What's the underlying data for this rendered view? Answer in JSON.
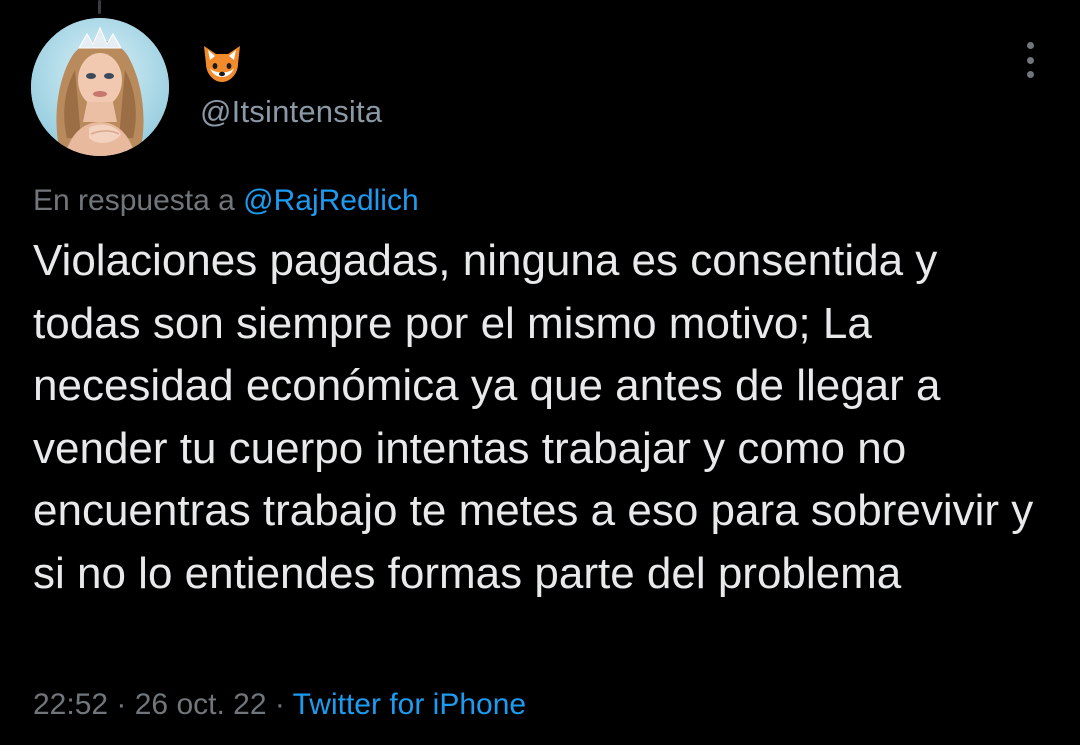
{
  "author": {
    "display_name_icon": "fox-face-emoji",
    "handle": "@Itsintensita",
    "avatar": "profile-photo"
  },
  "reply": {
    "prefix": "En respuesta a",
    "mention": "@RajRedlich"
  },
  "tweet": {
    "text": "Violaciones pagadas, ninguna es consentida y todas son siempre por el mismo motivo; La necesidad económica ya que antes de llegar a vender tu cuerpo intentas trabajar y como no encuentras trabajo te metes a eso para sobrevivir y si no lo entiendes formas parte del problema"
  },
  "meta": {
    "time": "22:52",
    "separator1": " · ",
    "date": "26 oct. 22",
    "separator2": " · ",
    "source": "Twitter for iPhone"
  },
  "menu": {
    "icon": "more-vertical-icon"
  },
  "colors": {
    "background": "#000000",
    "text": "#e7e9ea",
    "secondary": "#71767b",
    "link": "#1d9bf0"
  }
}
